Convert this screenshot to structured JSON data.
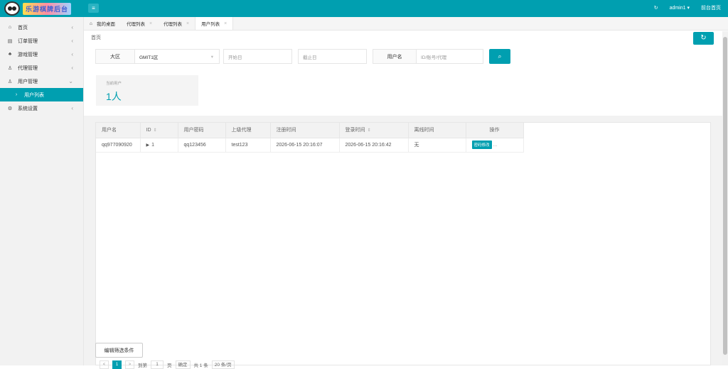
{
  "header": {
    "logo_text": "乐游棋牌后台",
    "menu_icon": "hamburger-icon",
    "refresh_icon": "refresh-icon",
    "user": "admin1",
    "front_link": "前台首页"
  },
  "sidebar": {
    "items": [
      {
        "label": "首页",
        "icon": "home-icon"
      },
      {
        "label": "订单管理",
        "icon": "order-icon"
      },
      {
        "label": "游戏管理",
        "icon": "game-icon"
      },
      {
        "label": "代理管理",
        "icon": "agent-icon"
      },
      {
        "label": "用户管理",
        "icon": "user-icon"
      },
      {
        "label": "用户列表",
        "icon": "chevron-right-icon"
      },
      {
        "label": "系统设置",
        "icon": "gear-icon"
      }
    ]
  },
  "tabs": {
    "items": [
      {
        "label": "我的桌面"
      },
      {
        "label": "代理列表"
      },
      {
        "label": "代理列表"
      },
      {
        "label": "用户列表"
      }
    ]
  },
  "breadcrumb": "首页",
  "filters": {
    "region_label": "大区",
    "region_value": "GMIT1区",
    "start_placeholder": "开始日",
    "end_placeholder": "截止日",
    "user_label": "用户名",
    "user_placeholder": "ID/账号/代理"
  },
  "stats": {
    "title": "当前用户",
    "value": "1人"
  },
  "table": {
    "headers": [
      "用户名",
      "ID",
      "用户密码",
      "上级代理",
      "注册时间",
      "登录时间",
      "离线时间",
      "操作"
    ],
    "rows": [
      {
        "username": "qq977090920",
        "id": "1",
        "password": "qq123456",
        "parent": "test123",
        "reg_time": "2026-06-15 20:16:07",
        "login_time": "2026-06-15 20:16:42",
        "offline_time": "无",
        "action": "密码修改",
        "more": "..."
      }
    ]
  },
  "edit_button": "编辑筛选条件",
  "pager": {
    "prev": "<",
    "current": "1",
    "next": ">",
    "goto": "到第",
    "page_input": "1",
    "page_unit": "页",
    "confirm": "确定",
    "total": "共 1 条",
    "per_page": "20 条/页"
  },
  "colors": {
    "accent": "#009fb0"
  }
}
